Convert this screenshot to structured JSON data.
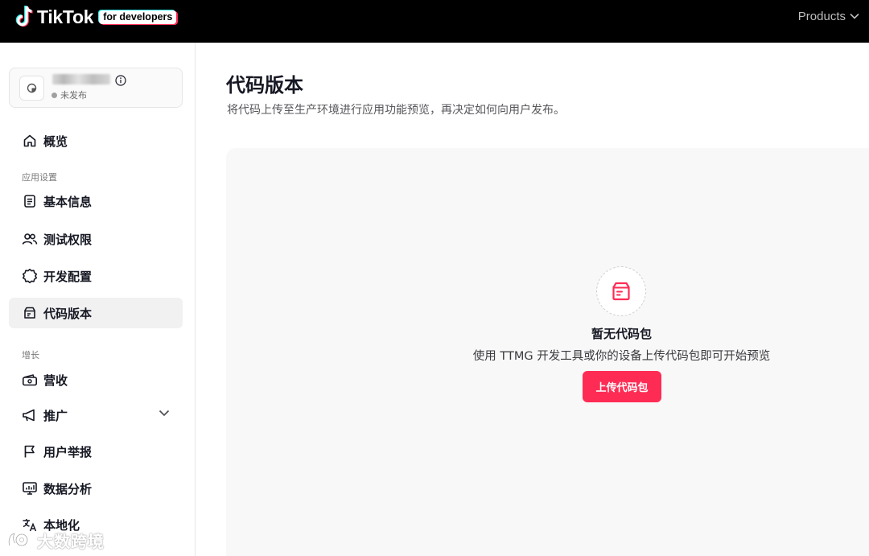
{
  "header": {
    "logo_word": "TikTok",
    "logo_badge": "for developers",
    "products_label": "Products"
  },
  "app": {
    "status": "未发布"
  },
  "sidebar": {
    "items": [
      {
        "label": "概览",
        "icon": "home-icon"
      },
      {
        "label": "基本信息",
        "icon": "document-icon"
      },
      {
        "label": "测试权限",
        "icon": "users-icon"
      },
      {
        "label": "开发配置",
        "icon": "gear-icon"
      },
      {
        "label": "代码版本",
        "icon": "package-icon",
        "active": true
      },
      {
        "label": "营收",
        "icon": "wallet-icon"
      },
      {
        "label": "推广",
        "icon": "megaphone-icon",
        "expandable": true
      },
      {
        "label": "用户举报",
        "icon": "flag-icon"
      },
      {
        "label": "数据分析",
        "icon": "chart-monitor-icon"
      },
      {
        "label": "本地化",
        "icon": "translate-icon"
      }
    ],
    "sections": {
      "app_settings": "应用设置",
      "growth": "增长"
    }
  },
  "main": {
    "title": "代码版本",
    "description": "将代码上传至生产环境进行应用功能预览，再决定如何向用户发布。",
    "empty": {
      "title": "暂无代码包",
      "description": "使用 TTMG 开发工具或你的设备上传代码包即可开始预览",
      "button": "上传代码包"
    }
  },
  "watermark": {
    "text": "大数跨境"
  },
  "colors": {
    "accent": "#fe2c55",
    "topbar": "#000000",
    "active_item_bg": "#f1f1f2",
    "panel_bg": "#f8f8f8"
  }
}
